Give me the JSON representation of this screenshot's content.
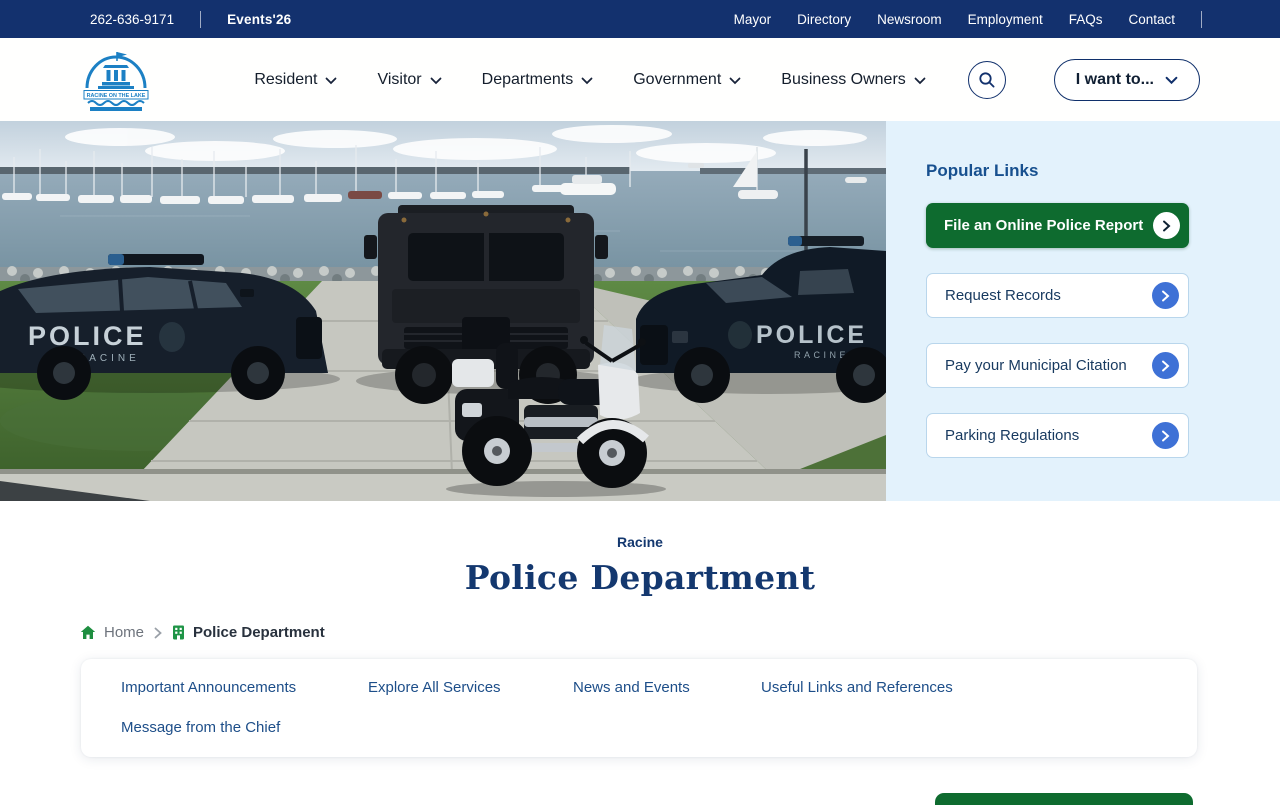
{
  "topbar": {
    "phone": "262-636-9171",
    "events": "Events'26",
    "links": [
      "Mayor",
      "Directory",
      "Newsroom",
      "Employment",
      "FAQs",
      "Contact"
    ]
  },
  "header": {
    "logo_text": "RACINE ON THE LAKE",
    "nav": [
      "Resident",
      "Visitor",
      "Departments",
      "Government",
      "Business Owners"
    ],
    "i_want_to": "I want to..."
  },
  "sidebar": {
    "heading": "Popular Links",
    "primary_link": "File an Online Police Report",
    "links": [
      "Request Records",
      "Pay your Municipal Citation",
      "Parking Regulations"
    ]
  },
  "hero": {
    "suv_label": "POLICE",
    "suv_sub": "RACINE",
    "pickup_label": "POLICE",
    "pickup_sub": "RACINE"
  },
  "page": {
    "eyebrow": "Racine",
    "title": "Police Department"
  },
  "breadcrumb": {
    "home": "Home",
    "current": "Police Department"
  },
  "quicklinks": [
    "Important Announcements",
    "Explore All Services",
    "News and Events",
    "Useful Links and References",
    "Message from the Chief"
  ],
  "colors": {
    "topbar_navy": "#13316e",
    "accent_green": "#0e6b2f",
    "accent_blue": "#3e71d6",
    "sidebar_light_blue": "#e3f2fc",
    "title_navy": "#14386f",
    "link_blue": "#1d4e89",
    "logo_blue": "#1c80c4",
    "breadcrumb_green": "#1e8e40"
  }
}
